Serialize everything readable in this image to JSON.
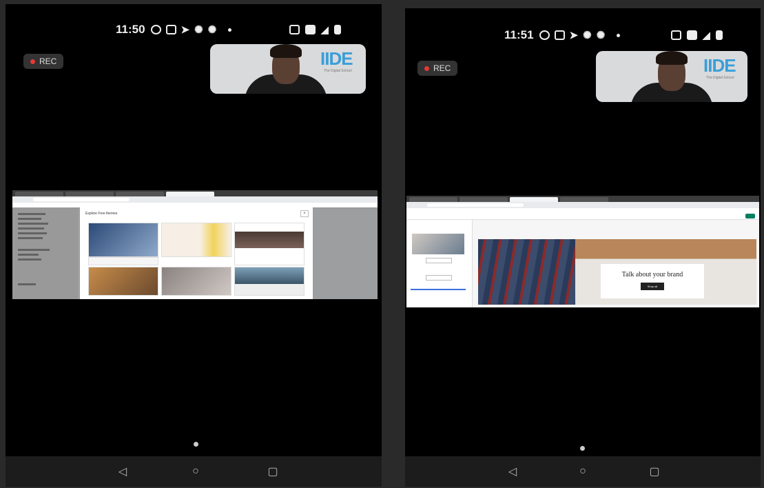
{
  "left_phone": {
    "time": "11:50",
    "rec_label": "REC",
    "cam_logo": "IIDE",
    "cam_logo_sub": "The Digital School",
    "modal_title": "Explore Free themes",
    "modal_close": "×"
  },
  "right_phone": {
    "time": "11:51",
    "rec_label": "REC",
    "cam_logo": "IIDE",
    "cam_logo_sub": "The Digital School",
    "hero_heading": "Talk about your brand",
    "hero_button": "Shop all"
  },
  "nav": {
    "back_icon": "◁",
    "home_icon": "○",
    "recents_icon": "▢"
  },
  "colors": {
    "rec_dot": "#e53935",
    "save_button": "#008060",
    "logo_blue": "#3a9ed8"
  },
  "icons": [
    "whatsapp-icon",
    "message-icon",
    "telegram-icon",
    "settings-icon",
    "signal-icon",
    "battery-icon"
  ]
}
